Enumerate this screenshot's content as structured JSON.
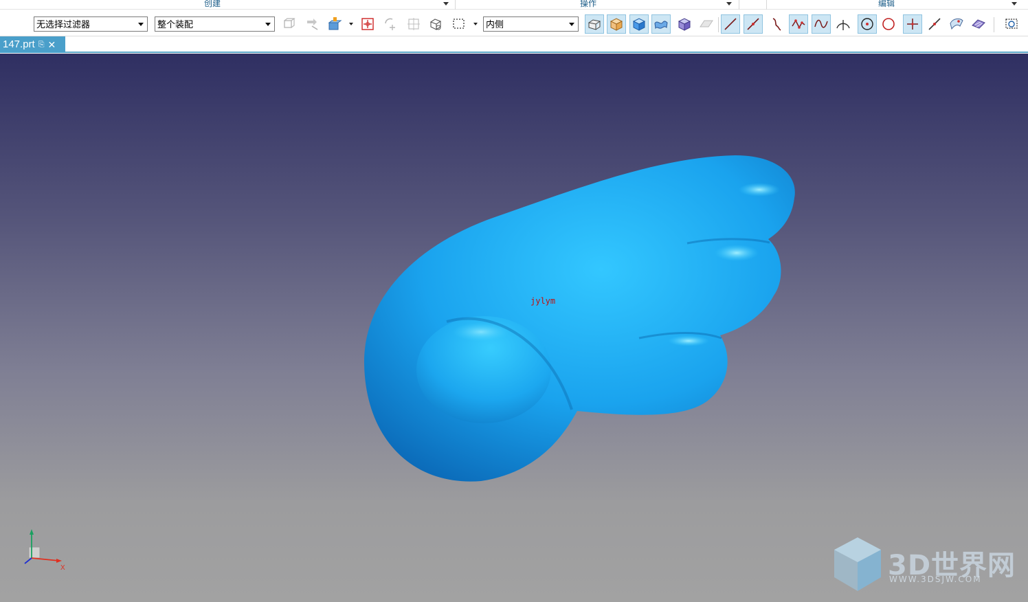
{
  "ribbon_groups": [
    {
      "label": "创建"
    },
    {
      "label": "操作"
    },
    {
      "label": "编辑"
    }
  ],
  "toolbar": {
    "selection_filter": {
      "value": "无选择过滤器"
    },
    "assembly_scope": {
      "value": "整个装配"
    },
    "selection_mode": {
      "value": "内侧"
    }
  },
  "document_tab": {
    "name": "147.prt"
  },
  "viewport": {
    "model_annotation": "jylym",
    "triad_axis_label": "X",
    "watermark_title": "3D世界网",
    "watermark_url": "WWW.3DSJW.COM",
    "model_color": "#1fa6ee",
    "background_top": "#2f2f62",
    "background_bottom": "#a2a2a2"
  },
  "icons": [
    "feature-snap-icon",
    "arrow-pick-icon",
    "solid-drop-icon",
    "point-snap-icon",
    "rotate-snap-icon",
    "grid-snap-icon",
    "box-select-icon",
    "rect-select-icon",
    "wire-box-icon",
    "shaded-box-icon",
    "blue-box-icon",
    "sheet-icon",
    "cube-icon",
    "faded-sheet-icon",
    "line-icon",
    "line-end-icon",
    "curve-icon",
    "polyline-icon",
    "spline-icon",
    "intersect-icon",
    "circle-center-icon",
    "circle-icon",
    "cross-icon",
    "diag-line-icon",
    "surface-icon",
    "face-icon",
    "zoom-window-icon"
  ]
}
